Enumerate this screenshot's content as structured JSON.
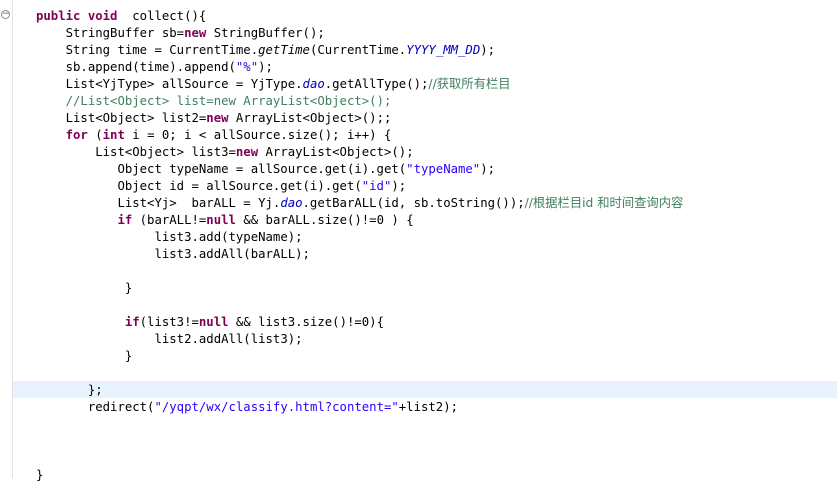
{
  "editor": {
    "fold_icon": "minus",
    "lines": [
      {
        "indent": "",
        "segments": [
          {
            "t": "public",
            "c": "kw"
          },
          {
            "t": " "
          },
          {
            "t": "void",
            "c": "kw"
          },
          {
            "t": "  collect(){"
          }
        ]
      },
      {
        "indent": "    ",
        "segments": [
          {
            "t": "StringBuffer sb="
          },
          {
            "t": "new",
            "c": "kw"
          },
          {
            "t": " StringBuffer();"
          }
        ]
      },
      {
        "indent": "    ",
        "segments": [
          {
            "t": "String time = CurrentTime."
          },
          {
            "t": "getTime",
            "c": "ital"
          },
          {
            "t": "(CurrentTime."
          },
          {
            "t": "YYYY_MM_DD",
            "c": "stat"
          },
          {
            "t": ");"
          }
        ]
      },
      {
        "indent": "    ",
        "segments": [
          {
            "t": "sb.append(time).append("
          },
          {
            "t": "\"%\"",
            "c": "str"
          },
          {
            "t": ");"
          }
        ]
      },
      {
        "indent": "    ",
        "segments": [
          {
            "t": "List<YjType> allSource = YjType."
          },
          {
            "t": "dao",
            "c": "stat"
          },
          {
            "t": ".getAllType();"
          },
          {
            "t": "//获取所有栏目",
            "c": "cmt"
          }
        ]
      },
      {
        "indent": "    ",
        "segments": [
          {
            "t": "//List<Object> list=new ArrayList<Object>();",
            "c": "cmt"
          }
        ]
      },
      {
        "indent": "    ",
        "segments": [
          {
            "t": "List<Object> list2="
          },
          {
            "t": "new",
            "c": "kw"
          },
          {
            "t": " ArrayList<Object>();;"
          }
        ]
      },
      {
        "indent": "    ",
        "segments": [
          {
            "t": "for",
            "c": "kw"
          },
          {
            "t": " ("
          },
          {
            "t": "int",
            "c": "kw"
          },
          {
            "t": " i = 0; i < allSource.size(); i++) {"
          }
        ]
      },
      {
        "indent": "        ",
        "segments": [
          {
            "t": "List<Object> list3="
          },
          {
            "t": "new",
            "c": "kw"
          },
          {
            "t": " ArrayList<Object>();"
          }
        ]
      },
      {
        "indent": "           ",
        "segments": [
          {
            "t": "Object typeName = allSource.get(i).get("
          },
          {
            "t": "\"typeName\"",
            "c": "str"
          },
          {
            "t": ");"
          }
        ]
      },
      {
        "indent": "           ",
        "segments": [
          {
            "t": "Object id = allSource.get(i).get("
          },
          {
            "t": "\"id\"",
            "c": "str"
          },
          {
            "t": ");"
          }
        ]
      },
      {
        "indent": "           ",
        "segments": [
          {
            "t": "List<Yj>  barALL = Yj."
          },
          {
            "t": "dao",
            "c": "stat"
          },
          {
            "t": ".getBarALL(id, sb.toString());"
          },
          {
            "t": "//根据栏目id 和时间查询内容",
            "c": "cmt"
          }
        ]
      },
      {
        "indent": "           ",
        "segments": [
          {
            "t": "if",
            "c": "kw"
          },
          {
            "t": " (barALL!="
          },
          {
            "t": "null",
            "c": "kw"
          },
          {
            "t": " && barALL.size()!=0 ) {"
          }
        ]
      },
      {
        "indent": "                ",
        "segments": [
          {
            "t": "list3.add(typeName);"
          }
        ]
      },
      {
        "indent": "                ",
        "segments": [
          {
            "t": "list3.addAll(barALL);"
          }
        ]
      },
      {
        "indent": "",
        "segments": []
      },
      {
        "indent": "            ",
        "segments": [
          {
            "t": "}"
          }
        ]
      },
      {
        "indent": "",
        "segments": []
      },
      {
        "indent": "            ",
        "segments": [
          {
            "t": "if",
            "c": "kw"
          },
          {
            "t": "(list3!="
          },
          {
            "t": "null",
            "c": "kw"
          },
          {
            "t": " && list3.size()!=0){"
          }
        ]
      },
      {
        "indent": "                ",
        "segments": [
          {
            "t": "list2.addAll(list3);"
          }
        ]
      },
      {
        "indent": "            ",
        "segments": [
          {
            "t": "}"
          }
        ]
      },
      {
        "indent": "",
        "segments": []
      },
      {
        "indent": "       ",
        "segments": [
          {
            "t": "};"
          }
        ]
      },
      {
        "indent": "       ",
        "segments": [
          {
            "t": "redirect("
          },
          {
            "t": "\"/yqpt/wx/classify.html?content=\"",
            "c": "str"
          },
          {
            "t": "+list2);"
          }
        ]
      },
      {
        "indent": "",
        "segments": []
      },
      {
        "indent": "",
        "segments": []
      },
      {
        "indent": "",
        "segments": []
      },
      {
        "indent": "",
        "segments": [
          {
            "t": "}"
          }
        ]
      }
    ]
  },
  "colors": {
    "keyword": "#7f0055",
    "string": "#2a00ff",
    "comment": "#3f7f5f",
    "static_field": "#0000c0",
    "current_line": "#e8f2fe"
  }
}
